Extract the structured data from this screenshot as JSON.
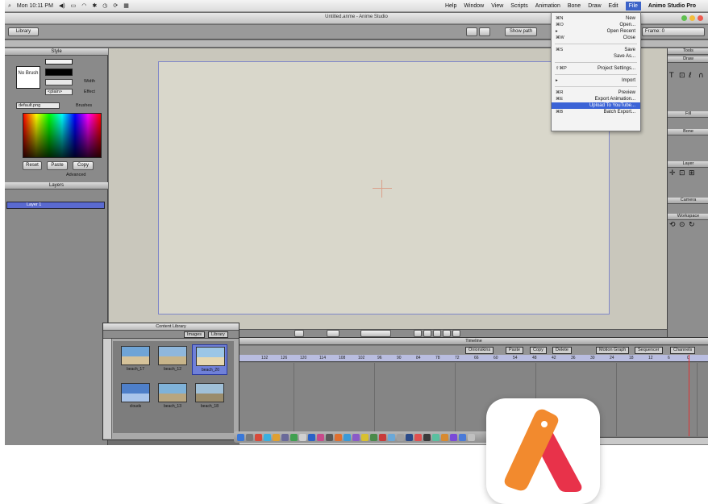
{
  "menubar": {
    "clock": "Mon 10:11 PM",
    "items": [
      "Animo Studio Pro",
      "File",
      "Edit",
      "Draw",
      "Bone",
      "Animation",
      "Scripts",
      "View",
      "Window",
      "Help"
    ]
  },
  "window": {
    "title": "Untitled.anme - Anime Studio"
  },
  "toolbar": {
    "library_button": "Library",
    "show_path_label": "Show path",
    "frame_label": "Frame: 0"
  },
  "style_panel": {
    "title": "Style",
    "no_brush": "No Brush",
    "width_label": "Width",
    "effect_label": "Effect",
    "effect_value": "<plain>",
    "brush_label": "Brushes",
    "brush_value": "default.png",
    "copy": "Copy",
    "paste": "Paste",
    "reset": "Reset",
    "advanced": "Advanced"
  },
  "layers_panel": {
    "title": "Layers",
    "layer_name": "Layer 1"
  },
  "tools_panel": {
    "title": "Tools",
    "sections": [
      "Draw",
      "Fill",
      "Bone",
      "Layer",
      "Camera",
      "Workspace"
    ]
  },
  "content_library": {
    "title": "Content Library",
    "tabs": [
      "Library",
      "Images"
    ],
    "items": [
      {
        "name": "beach_17",
        "selected": false,
        "colors": [
          "#6fa4d6",
          "#d6c39a"
        ]
      },
      {
        "name": "beach_12",
        "selected": false,
        "colors": [
          "#8fb7dc",
          "#c8b58a"
        ]
      },
      {
        "name": "beach_20",
        "selected": true,
        "colors": [
          "#9cc6e6",
          "#e6d7b0"
        ]
      },
      {
        "name": "clouds",
        "selected": false,
        "colors": [
          "#4e7fc9",
          "#a9c4ea"
        ]
      },
      {
        "name": "beach_13",
        "selected": false,
        "colors": [
          "#7fb2d9",
          "#b8a680"
        ]
      },
      {
        "name": "beach_18",
        "selected": false,
        "colors": [
          "#a0c0d8",
          "#9a8c6c"
        ]
      }
    ]
  },
  "timeline": {
    "title": "Timeline",
    "tabs": [
      "Channels",
      "Sequencer",
      "Motion Graph"
    ],
    "buttons": [
      "Delete",
      "Copy",
      "Paste"
    ],
    "onionskins": "Onionskins",
    "ruler": [
      "0",
      "6",
      "12",
      "18",
      "24",
      "30",
      "36",
      "42",
      "48",
      "54",
      "60",
      "66",
      "72",
      "78",
      "84",
      "90",
      "96",
      "102",
      "108",
      "114",
      "120",
      "126",
      "132"
    ]
  },
  "file_menu": {
    "items": [
      {
        "label": "New",
        "key": "⌘N"
      },
      {
        "label": "Open...",
        "key": "⌘O"
      },
      {
        "label": "Open Recent",
        "key": "▸"
      },
      {
        "label": "Close",
        "key": "⌘W"
      },
      {
        "sep": true
      },
      {
        "label": "Save",
        "key": "⌘S"
      },
      {
        "label": "Save As...",
        "key": ""
      },
      {
        "sep": true
      },
      {
        "label": "Project Settings...",
        "key": "⇧⌘P"
      },
      {
        "sep": true
      },
      {
        "label": "Import",
        "key": "▸"
      },
      {
        "sep": true
      },
      {
        "label": "Preview",
        "key": "⌘R"
      },
      {
        "label": "Export Animation...",
        "key": "⌘E"
      },
      {
        "label": "Upload To YouTube...",
        "key": "",
        "highlighted": true
      },
      {
        "label": "Batch Export...",
        "key": "⌘B"
      }
    ]
  },
  "colors": {
    "accent": "#3b63d6",
    "logo_orange": "#f28a2e",
    "logo_red": "#e8324a"
  }
}
